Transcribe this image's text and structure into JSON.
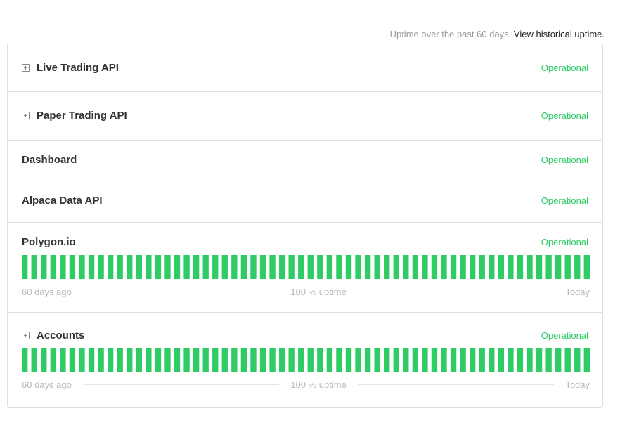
{
  "header": {
    "uptime_note": "Uptime over the past 60 days.",
    "historical_link": "View historical uptime."
  },
  "components": [
    {
      "name": "Live Trading API",
      "status": "Operational",
      "expandable": true,
      "show_uptime": false
    },
    {
      "name": "Paper Trading API",
      "status": "Operational",
      "expandable": true,
      "show_uptime": false
    },
    {
      "name": "Dashboard",
      "status": "Operational",
      "expandable": false,
      "show_uptime": false
    },
    {
      "name": "Alpaca Data API",
      "status": "Operational",
      "expandable": false,
      "show_uptime": false
    },
    {
      "name": "Polygon.io",
      "status": "Operational",
      "expandable": false,
      "show_uptime": true,
      "uptime": {
        "start_label": "60 days ago",
        "middle_label": "100 % uptime",
        "end_label": "Today",
        "days": 60
      }
    },
    {
      "name": "Accounts",
      "status": "Operational",
      "expandable": true,
      "show_uptime": true,
      "uptime": {
        "start_label": "60 days ago",
        "middle_label": "100 % uptime",
        "end_label": "Today",
        "days": 60
      }
    }
  ],
  "colors": {
    "operational": "#2fcc66",
    "bar": "#2fcc66"
  }
}
